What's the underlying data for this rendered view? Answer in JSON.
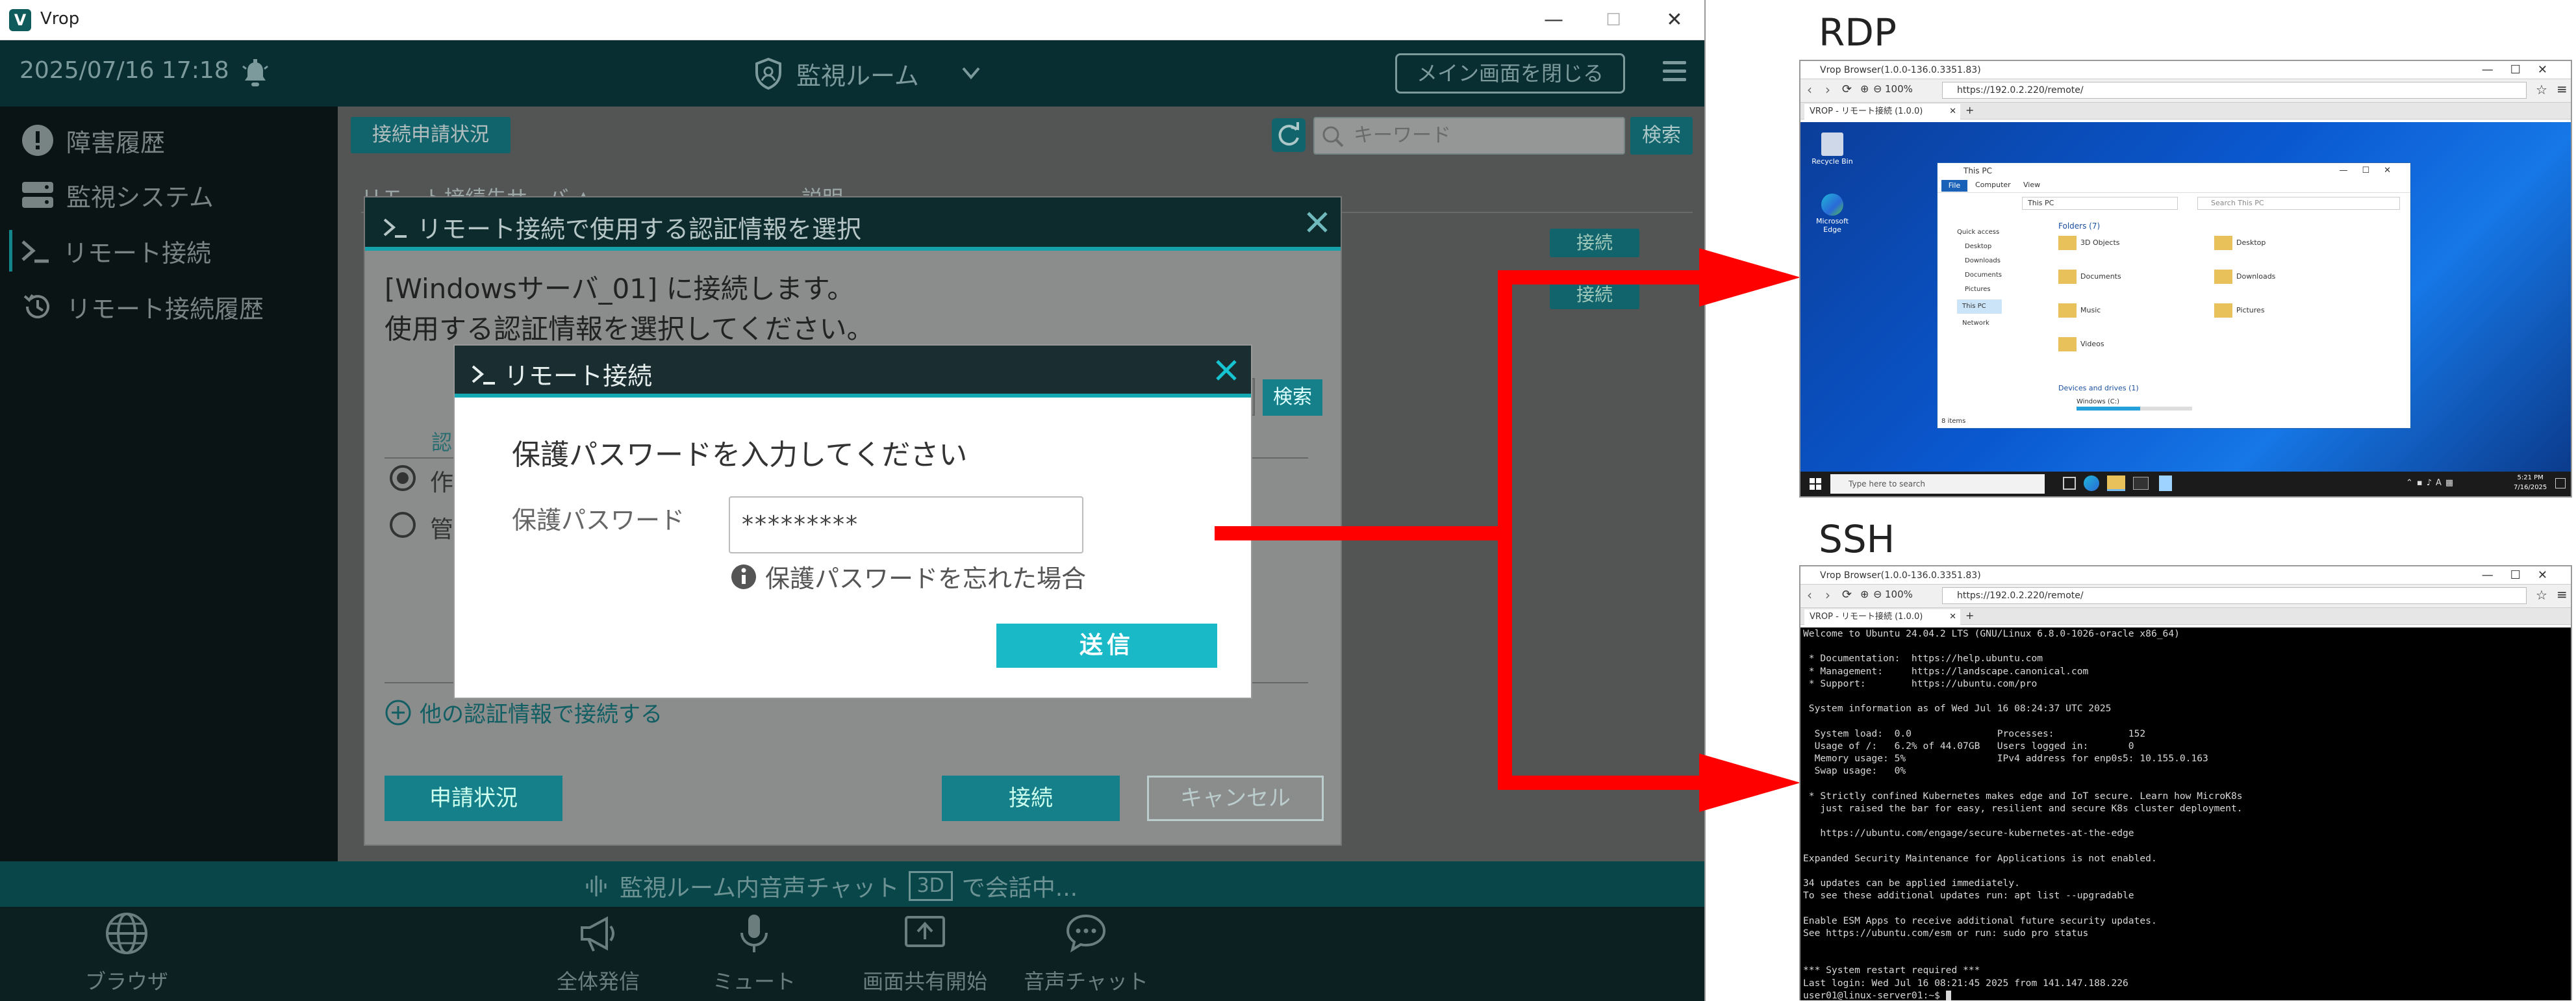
{
  "app": {
    "title": "Vrop",
    "logo_letter": "V",
    "datetime": "2025/07/16 17:18",
    "room_name": "監視ルーム",
    "close_main_label": "メイン画面を閉じる",
    "window_controls": [
      "—",
      "☐",
      "✕"
    ]
  },
  "sidebar": {
    "items": [
      {
        "label": "障害履歴",
        "icon": "alert-icon"
      },
      {
        "label": "監視システム",
        "icon": "server-icon"
      },
      {
        "label": "リモート接続",
        "icon": "terminal-icon",
        "active": true
      },
      {
        "label": "リモート接続履歴",
        "icon": "history-icon"
      }
    ]
  },
  "content": {
    "tab_label": "接続申請状況",
    "search_placeholder": "キーワード",
    "search_button": "検索",
    "col_server": "リモート接続先サーバ ▲",
    "col_desc": "説明",
    "connect_label": "接続"
  },
  "voice_bar": {
    "text_before": "監視ルーム内音声チャット",
    "badge": "3D",
    "text_after": "で会話中..."
  },
  "footer": {
    "items": [
      "ブラウザ",
      "全体発信",
      "ミュート",
      "画面共有開始",
      "音声チャット"
    ]
  },
  "cred_dialog": {
    "title": "リモート接続で使用する認証情報を選択",
    "message_line1": "[Windowsサーバ_01] に接続します。",
    "message_line2": "使用する認証情報を選択してください。",
    "search_button": "検索",
    "col_label": "認",
    "radio1_label": "作",
    "radio2_label": "管",
    "other_link": "他の認証情報で接続する",
    "apply_status_button": "申請状況",
    "connect_button": "接続",
    "cancel_button": "キャンセル"
  },
  "pw_dialog": {
    "title": "リモート接続",
    "heading": "保護パスワードを入力してください",
    "label": "保護パスワード",
    "value": "*********",
    "forgot_link": "保護パスワードを忘れた場合",
    "send_button": "送信"
  },
  "rdp": {
    "label": "RDP",
    "window_title": "Vrop Browser(1.0.0-136.0.3351.83)",
    "zoom": "100%",
    "url": "https://192.0.2.220/remote/",
    "tab": "VROP - リモート接続 (1.0.0)",
    "explorer": {
      "title": "This PC",
      "ribbon": [
        "File",
        "Computer",
        "View"
      ],
      "address": "This PC",
      "search_placeholder": "Search This PC",
      "folders_header": "Folders (7)",
      "folders": [
        "3D Objects",
        "Desktop",
        "Documents",
        "Downloads",
        "Music",
        "Pictures",
        "Videos"
      ],
      "nav": [
        "Quick access",
        "Desktop",
        "Downloads",
        "Documents",
        "Pictures",
        "This PC",
        "Network"
      ],
      "drives_header": "Devices and drives (1)",
      "drive": "Windows (C:)",
      "status": "8 items"
    },
    "desktop_icons": [
      "Recycle Bin",
      "Microsoft Edge"
    ],
    "taskbar": {
      "search_placeholder": "Type here to search",
      "time": "5:21 PM",
      "date": "7/16/2025"
    }
  },
  "ssh": {
    "label": "SSH",
    "window_title": "Vrop Browser(1.0.0-136.0.3351.83)",
    "zoom": "100%",
    "url": "https://192.0.2.220/remote/",
    "tab": "VROP - リモート接続 (1.0.0)",
    "terminal_lines": [
      "Welcome to Ubuntu 24.04.2 LTS (GNU/Linux 6.8.0-1026-oracle x86_64)",
      "",
      " * Documentation:  https://help.ubuntu.com",
      " * Management:     https://landscape.canonical.com",
      " * Support:        https://ubuntu.com/pro",
      "",
      " System information as of Wed Jul 16 08:24:37 UTC 2025",
      "",
      "  System load:  0.0               Processes:             152",
      "  Usage of /:   6.2% of 44.07GB   Users logged in:       0",
      "  Memory usage: 5%                IPv4 address for enp0s5: 10.155.0.163",
      "  Swap usage:   0%",
      "",
      " * Strictly confined Kubernetes makes edge and IoT secure. Learn how MicroK8s",
      "   just raised the bar for easy, resilient and secure K8s cluster deployment.",
      "",
      "   https://ubuntu.com/engage/secure-kubernetes-at-the-edge",
      "",
      "Expanded Security Maintenance for Applications is not enabled.",
      "",
      "34 updates can be applied immediately.",
      "To see these additional updates run: apt list --upgradable",
      "",
      "Enable ESM Apps to receive additional future security updates.",
      "See https://ubuntu.com/esm or run: sudo pro status",
      "",
      "",
      "*** System restart required ***",
      "Last login: Wed Jul 16 08:21:45 2025 from 141.147.188.226",
      "user01@linux-server01:~$ "
    ]
  },
  "colors": {
    "teal_dark": "#0b3b40",
    "teal_accent": "#15a9b3",
    "send_button": "#19b9c8",
    "arrow": "#ff0000"
  }
}
